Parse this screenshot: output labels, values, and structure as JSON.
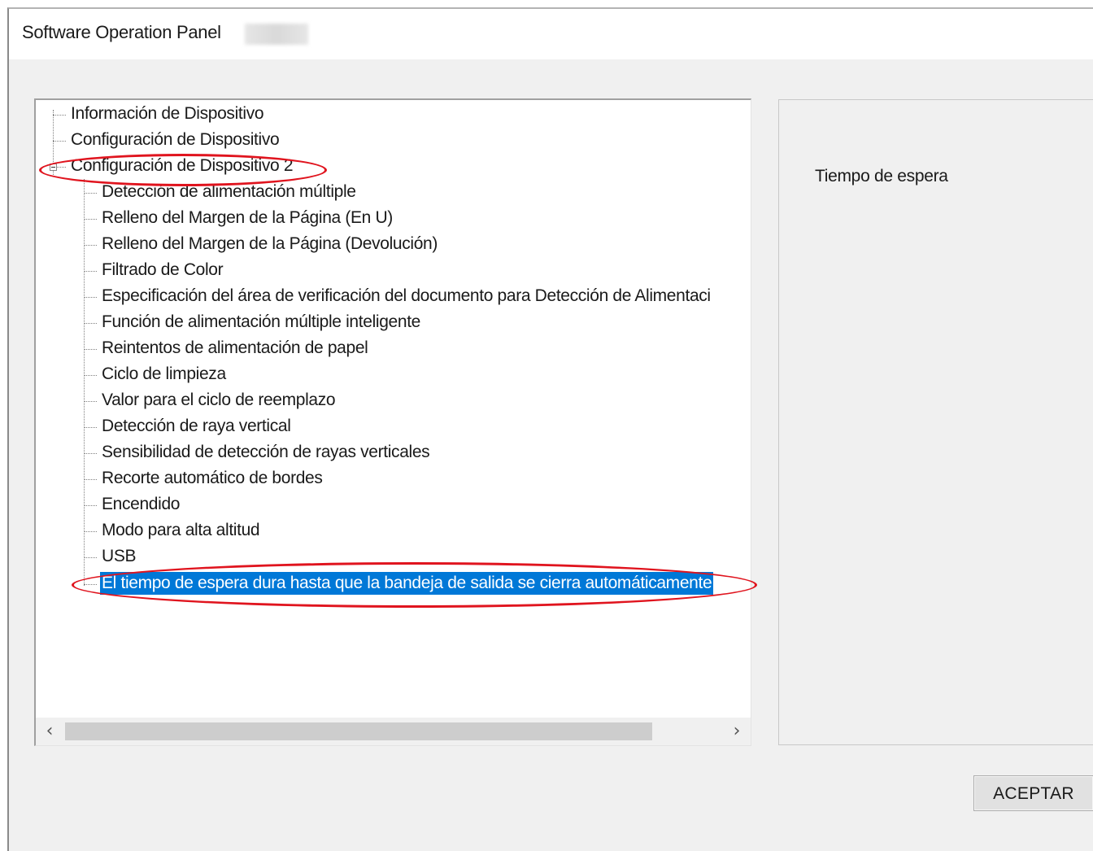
{
  "window": {
    "title": "Software Operation Panel"
  },
  "tree": {
    "items": [
      {
        "label": "Información de Dispositivo"
      },
      {
        "label": "Configuración de Dispositivo"
      },
      {
        "label": "Configuración de Dispositivo 2"
      },
      {
        "label": "Detección de alimentación múltiple"
      },
      {
        "label": "Relleno del Margen de la Página (En U)"
      },
      {
        "label": "Relleno del Margen de la Página (Devolución)"
      },
      {
        "label": "Filtrado de Color"
      },
      {
        "label": "Especificación del área de verificación del documento para Detección de Alimentaci"
      },
      {
        "label": "Función de alimentación múltiple inteligente"
      },
      {
        "label": "Reintentos de alimentación de papel"
      },
      {
        "label": "Ciclo de limpieza"
      },
      {
        "label": "Valor para el ciclo de reemplazo"
      },
      {
        "label": "Detección de raya vertical"
      },
      {
        "label": "Sensibilidad de detección de rayas verticales"
      },
      {
        "label": "Recorte automático de bordes"
      },
      {
        "label": "Encendido"
      },
      {
        "label": "Modo para alta altitud"
      },
      {
        "label": "USB"
      },
      {
        "label": "El tiempo de espera dura hasta que la bandeja de salida se cierra automáticamente"
      }
    ],
    "selected_index": 18,
    "scroll_left_icon": "chevron-left-icon",
    "scroll_right_icon": "chevron-right-icon"
  },
  "info_panel": {
    "text": "Tiempo de espera"
  },
  "buttons": {
    "ok_label": "ACEPTAR"
  },
  "colors": {
    "selection": "#0078d7",
    "callout": "#e0141e"
  }
}
